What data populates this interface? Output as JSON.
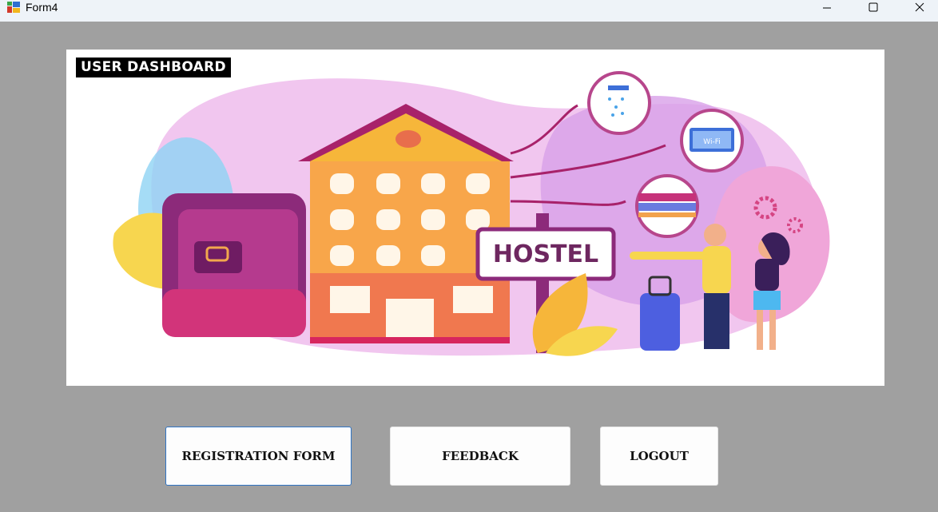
{
  "window": {
    "title": "Form4",
    "controls": [
      "minimize",
      "maximize",
      "close"
    ]
  },
  "banner": {
    "label": "USER DASHBOARD",
    "sign_text": "HOSTEL",
    "wifi_text": "Wi-Fi"
  },
  "buttons": {
    "registration": "REGISTRATION FORM",
    "feedback": "FEEDBACK",
    "logout": "LOGOUT"
  }
}
